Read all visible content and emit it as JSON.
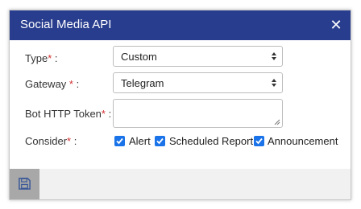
{
  "dialog": {
    "title": "Social Media API",
    "close_icon": "close-icon"
  },
  "form": {
    "type": {
      "label": "Type",
      "required_mark": "*",
      "suffix": " :",
      "value": "Custom"
    },
    "gateway": {
      "label": "Gateway ",
      "required_mark": "*",
      "suffix": " :",
      "value": "Telegram"
    },
    "token": {
      "label": "Bot HTTP Token",
      "required_mark": "*",
      "suffix": " :",
      "value": ""
    },
    "consider": {
      "label": "Consider",
      "required_mark": "*",
      "suffix": " :",
      "options": [
        {
          "label": "Alert",
          "checked": true
        },
        {
          "label": "Scheduled Report",
          "checked": true
        },
        {
          "label": "Announcement",
          "checked": true
        }
      ]
    }
  },
  "footer": {
    "save_icon": "save-icon"
  },
  "colors": {
    "header": "#283d8e",
    "checkbox": "#1a73e8",
    "required": "#d32f2f",
    "save_button": "#a8a8a8"
  }
}
